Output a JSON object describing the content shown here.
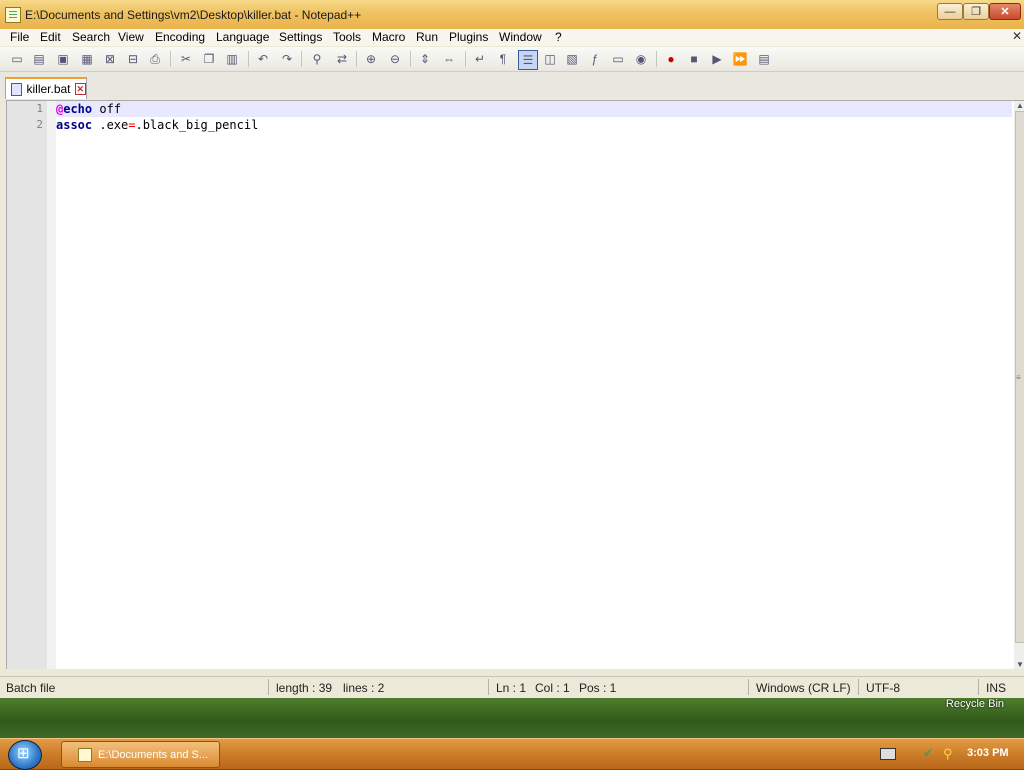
{
  "window": {
    "title": "E:\\Documents and Settings\\vm2\\Desktop\\killer.bat - Notepad++",
    "minimize_glyph": "—",
    "maximize_glyph": "❐",
    "close_glyph": "✕"
  },
  "menu": {
    "items": [
      "File",
      "Edit",
      "Search",
      "View",
      "Encoding",
      "Language",
      "Settings",
      "Tools",
      "Macro",
      "Run",
      "Plugins",
      "Window",
      "?"
    ],
    "close_glyph": "✕"
  },
  "toolbar": {
    "icons": [
      "new-file-icon",
      "open-file-icon",
      "save-icon",
      "save-all-icon",
      "close-icon",
      "close-all-icon",
      "print-icon",
      "cut-icon",
      "copy-icon",
      "paste-icon",
      "undo-icon",
      "redo-icon",
      "find-icon",
      "replace-icon",
      "zoom-in-icon",
      "zoom-out-icon",
      "sync-vertical-icon",
      "sync-horizontal-icon",
      "word-wrap-icon",
      "show-all-chars-icon",
      "indent-guide-icon",
      "user-defined-lang-icon",
      "doc-map-icon",
      "function-list-icon",
      "folder-as-workspace-icon",
      "monitoring-icon",
      "record-macro-icon",
      "stop-record-icon",
      "playback-macro-icon",
      "run-macro-multiple-icon",
      "save-macro-icon"
    ]
  },
  "tab": {
    "label": "killer.bat",
    "close_glyph": "✕"
  },
  "editor": {
    "lines": [
      {
        "number": "1",
        "tokens": [
          {
            "t": "@",
            "c": "at"
          },
          {
            "t": "echo",
            "c": "kw"
          },
          {
            "t": " off",
            "c": "plain"
          }
        ]
      },
      {
        "number": "2",
        "tokens": [
          {
            "t": "assoc",
            "c": "kw"
          },
          {
            "t": " .exe",
            "c": "plain"
          },
          {
            "t": "=",
            "c": "op"
          },
          {
            "t": ".black_big_pencil",
            "c": "plain"
          }
        ]
      }
    ]
  },
  "status": {
    "file_type": "Batch file",
    "length": "length : 39",
    "lines": "lines : 2",
    "ln": "Ln : 1",
    "col": "Col : 1",
    "pos": "Pos : 1",
    "eol": "Windows (CR LF)",
    "encoding": "UTF-8",
    "mode": "INS"
  },
  "desktop": {
    "recycle_bin": "Recycle Bin"
  },
  "taskbar": {
    "task_label": "E:\\Documents and S...",
    "clock": "3:03 PM"
  }
}
